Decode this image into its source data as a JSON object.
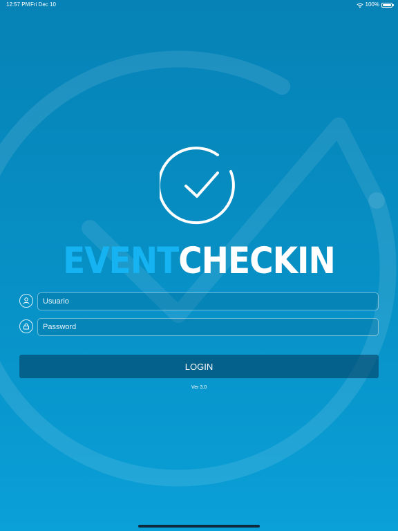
{
  "status_bar": {
    "time": "12:57 PM",
    "date": "Fri Dec 10",
    "battery": "100%",
    "wifi_icon": "wifi-icon",
    "battery_icon": "battery-icon"
  },
  "brand": {
    "logo_icon": "check-circle-icon",
    "word_event": "EVENT",
    "word_checkin": "CHECKIN",
    "accent_color": "#16b3f3",
    "background_color": "#0791c6"
  },
  "form": {
    "username": {
      "icon": "user-icon",
      "placeholder": "Usuario",
      "value": ""
    },
    "password": {
      "icon": "lock-icon",
      "placeholder": "Password",
      "value": ""
    },
    "login_label": "LOGIN"
  },
  "footer": {
    "version": "Ver 3.0"
  }
}
